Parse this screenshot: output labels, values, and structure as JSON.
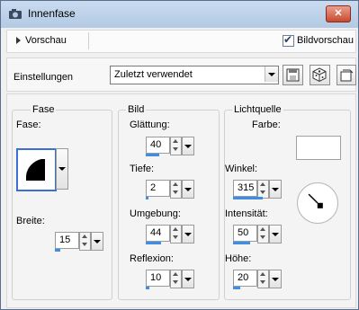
{
  "window": {
    "title": "Innenfase"
  },
  "preview": {
    "toggle_label": "Vorschau",
    "checkbox_label": "Bildvorschau",
    "checked": true
  },
  "settings": {
    "label": "Einstellungen",
    "preset_value": "Zuletzt verwendet"
  },
  "toolbar": {
    "icons": [
      "save-preset-icon",
      "randomize-icon",
      "reset-icon"
    ]
  },
  "fase_group": {
    "title": "Fase",
    "fase_label": "Fase:",
    "breite_label": "Breite:",
    "breite_value": "15",
    "breite_fill": 0.15
  },
  "bild_group": {
    "title": "Bild",
    "glaettung_label": "Glättung:",
    "glaettung_value": "40",
    "glaettung_fill": 0.4,
    "tiefe_label": "Tiefe:",
    "tiefe_value": "2",
    "tiefe_fill": 0.02,
    "umgebung_label": "Umgebung:",
    "umgebung_value": "44",
    "umgebung_fill": 0.44,
    "reflexion_label": "Reflexion:",
    "reflexion_value": "10",
    "reflexion_fill": 0.1
  },
  "licht_group": {
    "title": "Lichtquelle",
    "farbe_label": "Farbe:",
    "farbe_color": "#ffffff",
    "winkel_label": "Winkel:",
    "winkel_value": "315",
    "winkel_fill": 0.875,
    "intensitaet_label": "Intensität:",
    "intensitaet_value": "50",
    "intensitaet_fill": 0.5,
    "hoehe_label": "Höhe:",
    "hoehe_value": "20",
    "hoehe_fill": 0.2
  },
  "colors": {
    "accent": "#3d8ee6",
    "titlebar": "#c0d4ec"
  }
}
